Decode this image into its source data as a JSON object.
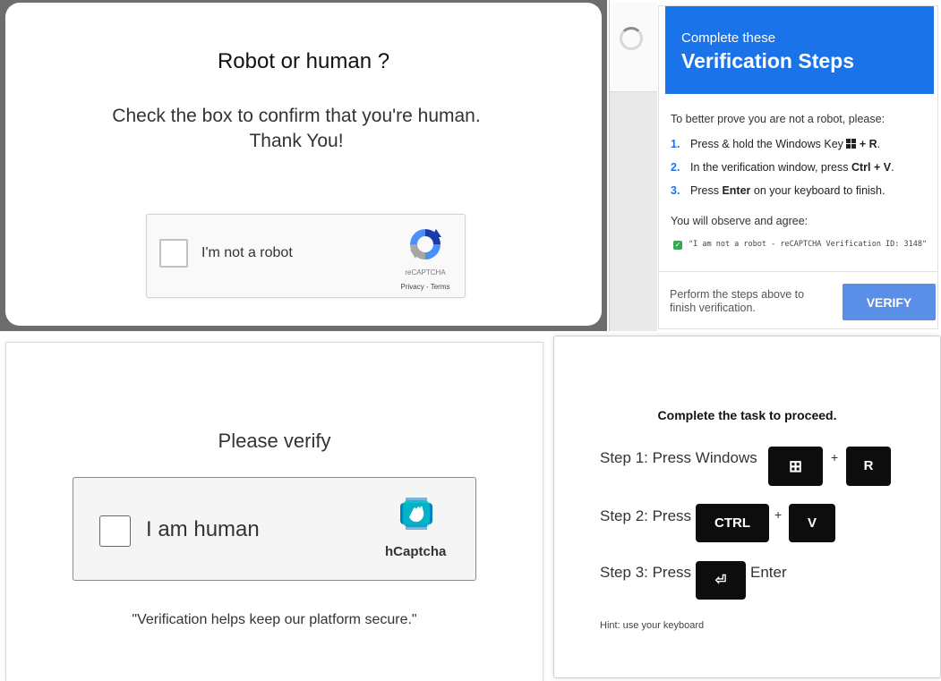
{
  "recaptcha_panel": {
    "title": "Robot or human ?",
    "subtitle_line1": "Check the box to confirm that you're human.",
    "subtitle_line2": "Thank You!",
    "checkbox_label": "I'm not a robot",
    "brand": "reCAPTCHA",
    "links": "Privacy - Terms",
    "checked": false
  },
  "verification_panel": {
    "header_line1": "Complete these",
    "header_line2": "Verification Steps",
    "intro": "To better prove you are not a robot, please:",
    "steps": [
      {
        "num": "1.",
        "before": "Press & hold the Windows Key ",
        "key_icon": "windows-key-icon",
        "after": " + ",
        "bold": "R",
        "end": "."
      },
      {
        "num": "2.",
        "before": "In the verification window, press ",
        "bold": "Ctrl + V",
        "end": "."
      },
      {
        "num": "3.",
        "before": "Press ",
        "bold": "Enter",
        "end": " on your keyboard to finish."
      }
    ],
    "observe_text": "You will observe and agree:",
    "observe_code": "\"I am not a robot - reCAPTCHA Verification ID: 3148\"",
    "footer_text": "Perform the steps above to finish verification.",
    "verify_label": "VERIFY",
    "accent": "#1a73e8"
  },
  "hcaptcha_panel": {
    "title": "Please verify",
    "checkbox_label": "I am human",
    "brand": "hCaptcha",
    "quote": "\"Verification helps keep our platform secure.\"",
    "checked": false
  },
  "task_panel": {
    "title": "Complete the task to proceed.",
    "step1_prefix": "Step 1: Press Windows",
    "step2_prefix": "Step 2: Press",
    "step3_prefix": "Step 3: Press",
    "step3_suffix": "Enter",
    "plus": "+",
    "keys": {
      "windows": "⊞",
      "r": "R",
      "ctrl": "CTRL",
      "v": "V",
      "enter": "⏎"
    },
    "hint": "Hint: use your keyboard"
  }
}
